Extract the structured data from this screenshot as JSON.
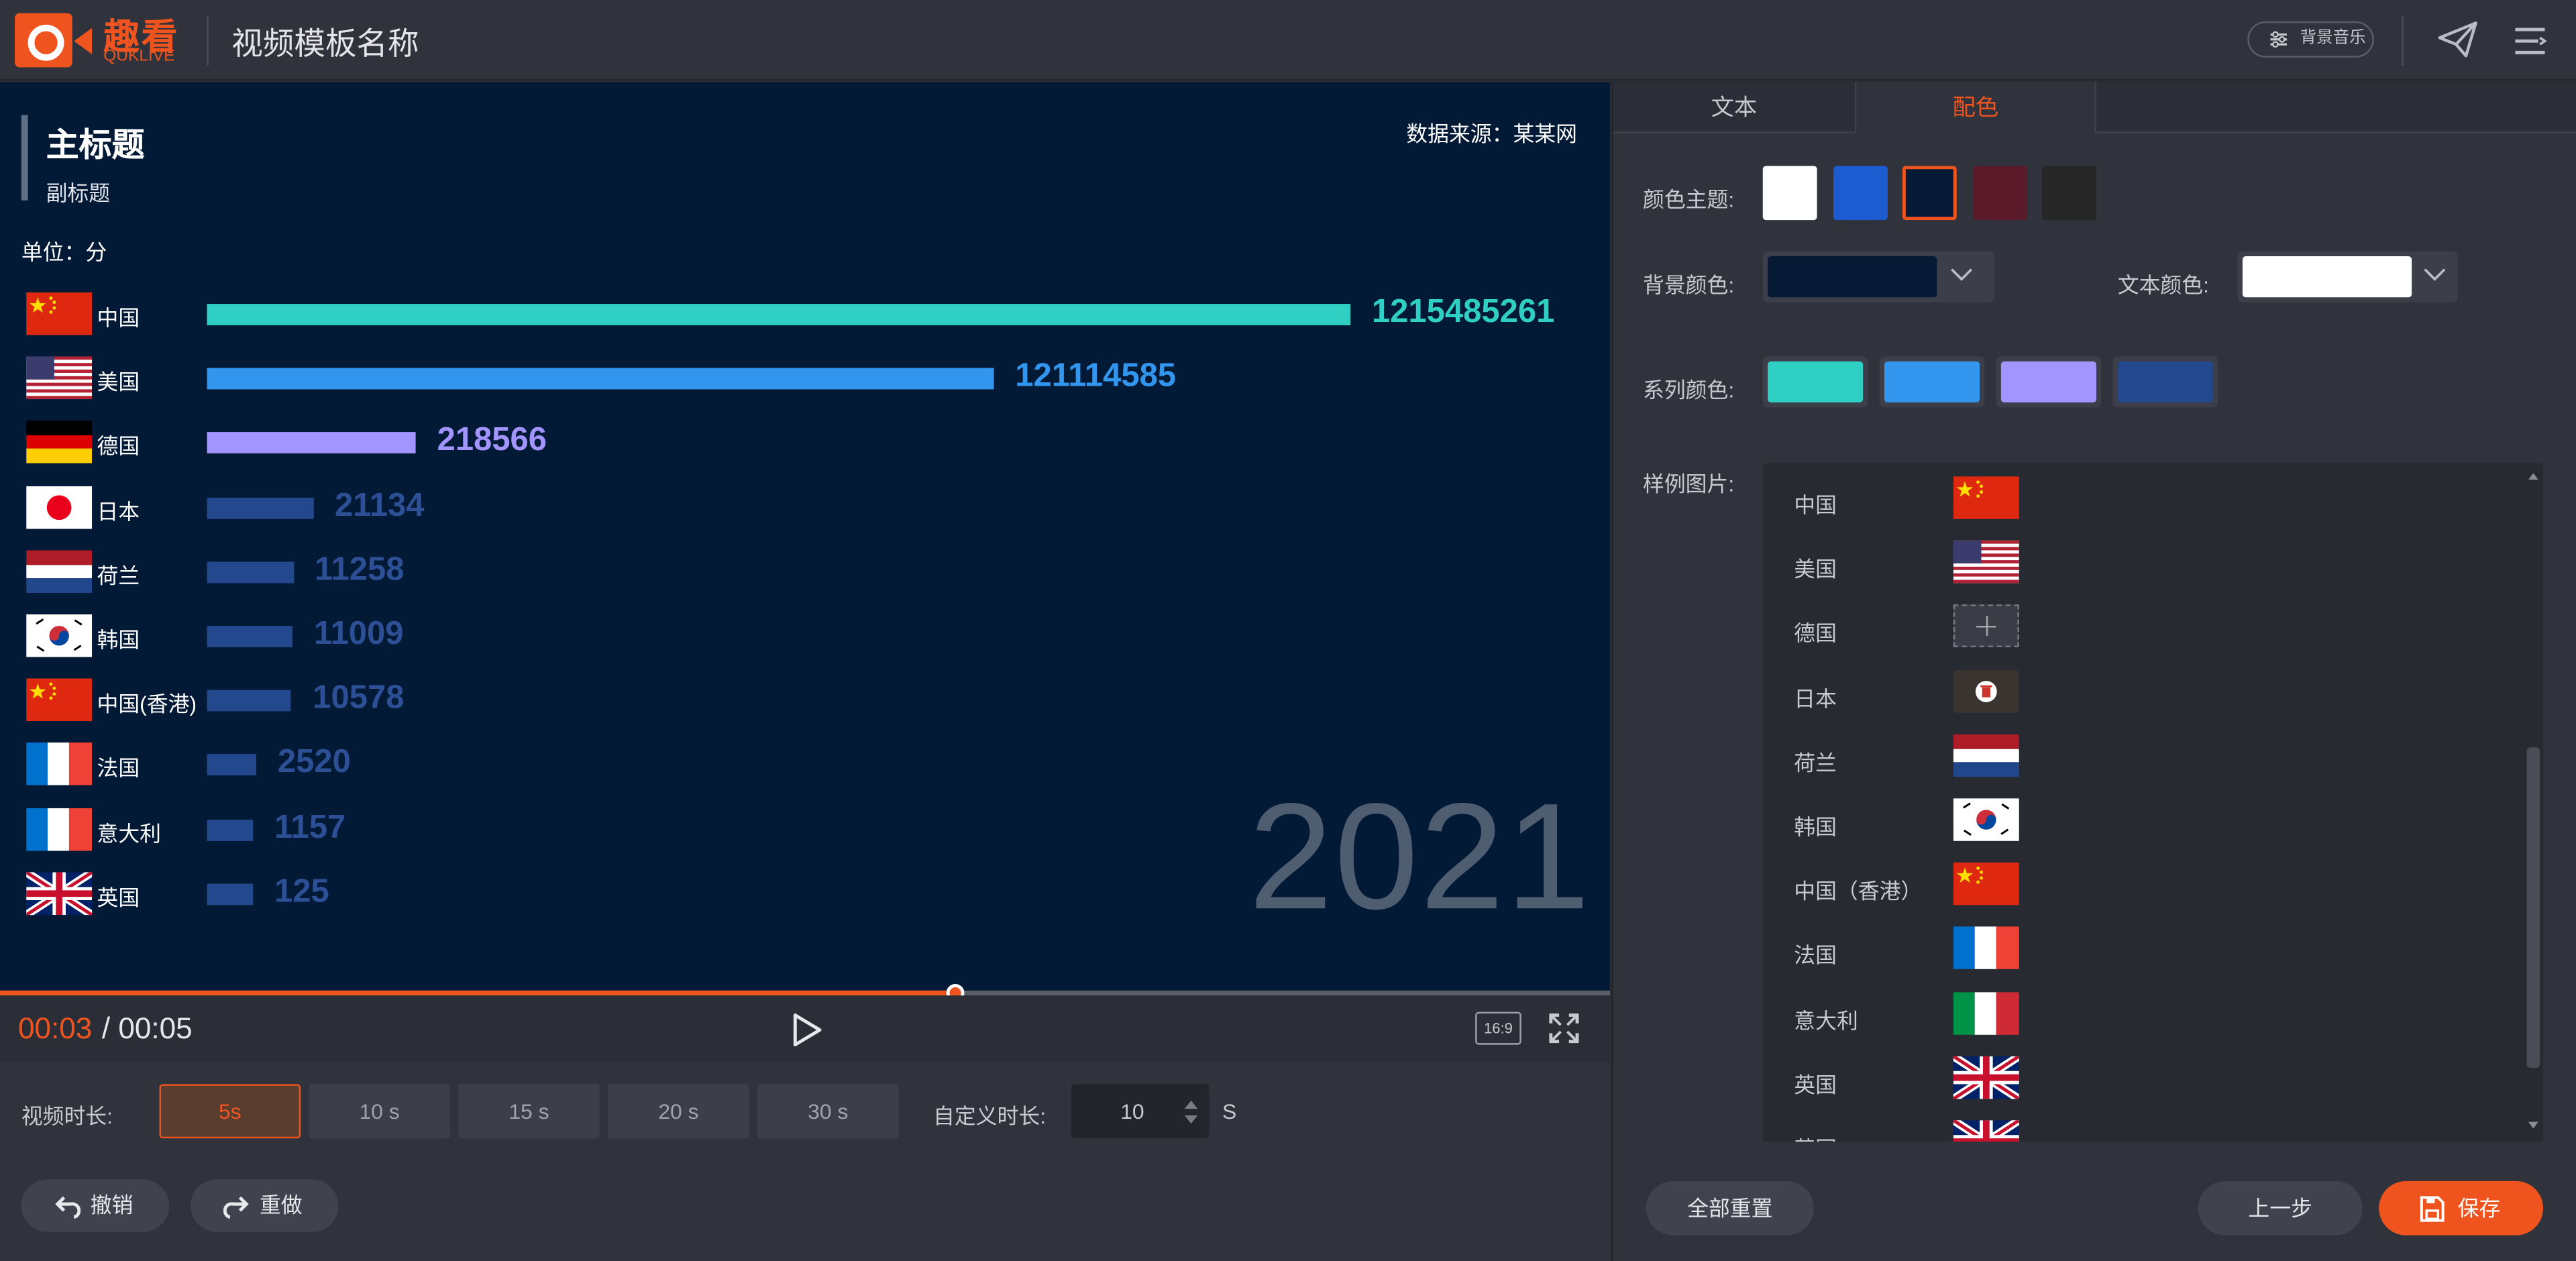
{
  "header": {
    "logo_cn": "趣看",
    "logo_en": "QUKLIVE",
    "title": "视频模板名称",
    "music_label": "背景音乐"
  },
  "video": {
    "main_title": "主标题",
    "sub_title": "副标题",
    "source": "数据来源：某某网",
    "unit": "单位：分",
    "year": "2021",
    "time_current": "00:03",
    "time_total": "/ 00:05",
    "ratio_label": "16:9",
    "progress_fraction": 0.593
  },
  "chart_data": {
    "type": "bar",
    "orientation": "horizontal",
    "categories": [
      "中国",
      "美国",
      "德国",
      "日本",
      "荷兰",
      "韩国",
      "中国(香港)",
      "法国",
      "意大利",
      "英国"
    ],
    "values": [
      1215485261,
      121114585,
      218566,
      21134,
      11258,
      11009,
      10578,
      2520,
      1157,
      125
    ],
    "value_labels": [
      "1215485261",
      "121114585",
      "218566",
      "21134",
      "11258",
      "11009",
      "10578",
      "2520",
      "1157",
      "125"
    ],
    "bar_colors": [
      "#2fcfc4",
      "#3396ee",
      "#a395ff",
      "#24488e",
      "#24488e",
      "#24488e",
      "#24488e",
      "#24488e",
      "#24488e",
      "#24488e"
    ],
    "label_colors": [
      "#2fcfc4",
      "#3396ee",
      "#a395ff",
      "#2d4f95",
      "#2d4f95",
      "#2d4f95",
      "#2d4f95",
      "#2d4f95",
      "#2d4f95",
      "#2d4f95"
    ],
    "flags": [
      "cn-flag",
      "us-flag",
      "de-flag",
      "jp-flag",
      "nl-flag",
      "kr-flag",
      "cn-flag",
      "fr-flag",
      "fr-flag",
      "gb-flag"
    ],
    "title": "主标题",
    "subtitle": "副标题",
    "unit": "单位：分",
    "year": "2021",
    "background": "#031a36"
  },
  "duration": {
    "label": "视频时长:",
    "options": [
      "5s",
      "10 s",
      "15 s",
      "20 s",
      "30 s"
    ],
    "selected": "5s",
    "custom_label": "自定义时长:",
    "custom_value": "10",
    "custom_unit": "S"
  },
  "actions": {
    "undo": "撤销",
    "redo": "重做"
  },
  "panel": {
    "tabs": [
      "文本",
      "配色"
    ],
    "active_tab": "配色",
    "theme_label": "颜色主题:",
    "theme_colors": [
      "#ffffff",
      "#1c5bd0",
      "#061a36",
      "#5a1a2a",
      "#262626"
    ],
    "theme_selected": "#061a36",
    "bg_label": "背景颜色:",
    "bg_color": "#061a36",
    "text_label": "文本颜色:",
    "text_color": "#ffffff",
    "series_label": "系列颜色:",
    "series_colors": [
      "#2fcfc4",
      "#3396ee",
      "#a395ff",
      "#24488e"
    ],
    "samples_label": "样例图片:",
    "samples": [
      {
        "name": "中国",
        "image": "cn-flag"
      },
      {
        "name": "美国",
        "image": "us-flag"
      },
      {
        "name": "德国",
        "image": "add-image"
      },
      {
        "name": "日本",
        "image": "delete"
      },
      {
        "name": "荷兰",
        "image": "nl-flag"
      },
      {
        "name": "韩国",
        "image": "kr-flag"
      },
      {
        "name": "中国（香港）",
        "image": "cn-flag"
      },
      {
        "name": "法国",
        "image": "fr-flag"
      },
      {
        "name": "意大利",
        "image": "it-flag"
      },
      {
        "name": "英国",
        "image": "gb-flag"
      },
      {
        "name": "英国",
        "image": "gb-flag"
      }
    ],
    "reset_label": "全部重置",
    "prev_label": "上一步",
    "save_label": "保存"
  },
  "colors": {
    "accent": "#f0541e"
  }
}
